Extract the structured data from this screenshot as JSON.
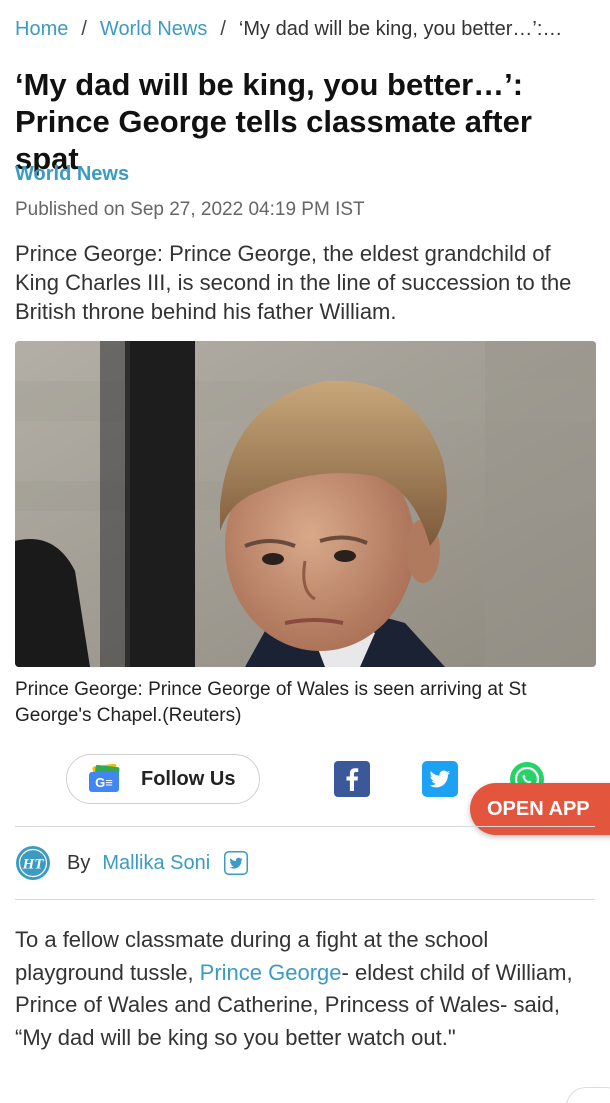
{
  "breadcrumb": {
    "home": "Home",
    "separator": "/",
    "section": "World News",
    "current": "‘My dad will be king, you better…’:…"
  },
  "article": {
    "headline": "‘My dad will be king, you better…’: Prince George tells classmate after spat",
    "section": "World News",
    "published": "Published on Sep 27, 2022 04:19 PM IST",
    "summary": "Prince George: Prince George, the eldest grandchild of King Charles III, is second in the line of succession to the British throne behind his father William.",
    "image_caption": "Prince George: Prince George of Wales is seen arriving at St George's Chapel.(Reuters)",
    "body_before_link": "To a fellow classmate during a fight at the school playground tussle, ",
    "body_link": "Prince George",
    "body_after_link": "- eldest child of William, Prince of Wales and Catherine, Princess of Wales- said, “My dad will be king so you better watch out.\""
  },
  "social": {
    "follow_label": "Follow Us",
    "follow_icon_text": "G≡",
    "icons": [
      "google-news-icon",
      "facebook-icon",
      "twitter-icon",
      "whatsapp-icon"
    ]
  },
  "open_app": "OPEN APP",
  "byline": {
    "by": "By",
    "author": "Mallika Soni",
    "logo_text": "HT"
  },
  "colors": {
    "link": "#3c9bc2",
    "open_app": "#e3553d",
    "facebook": "#3b5998",
    "twitter": "#1da1f2",
    "whatsapp": "#25d366"
  }
}
